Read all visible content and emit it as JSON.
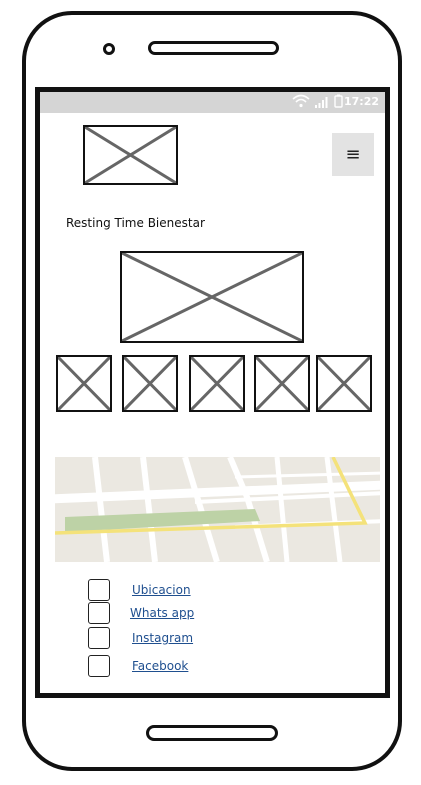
{
  "status_bar": {
    "time": "17:22",
    "icons": [
      "wifi-icon",
      "signal-icon",
      "battery-icon"
    ],
    "background": "#d5d5d5"
  },
  "header": {
    "brand_name": "Resting Time Bienestar",
    "menu_icon": "≡"
  },
  "links": [
    {
      "label": "Ubicacion"
    },
    {
      "label": "Whats app"
    },
    {
      "label": "Instagram"
    },
    {
      "label": "Facebook"
    }
  ],
  "colors": {
    "link": "#1f4f8f",
    "map_road": "#ffffff",
    "map_park": "#bdd2a6",
    "map_highway": "#f4e27a"
  }
}
